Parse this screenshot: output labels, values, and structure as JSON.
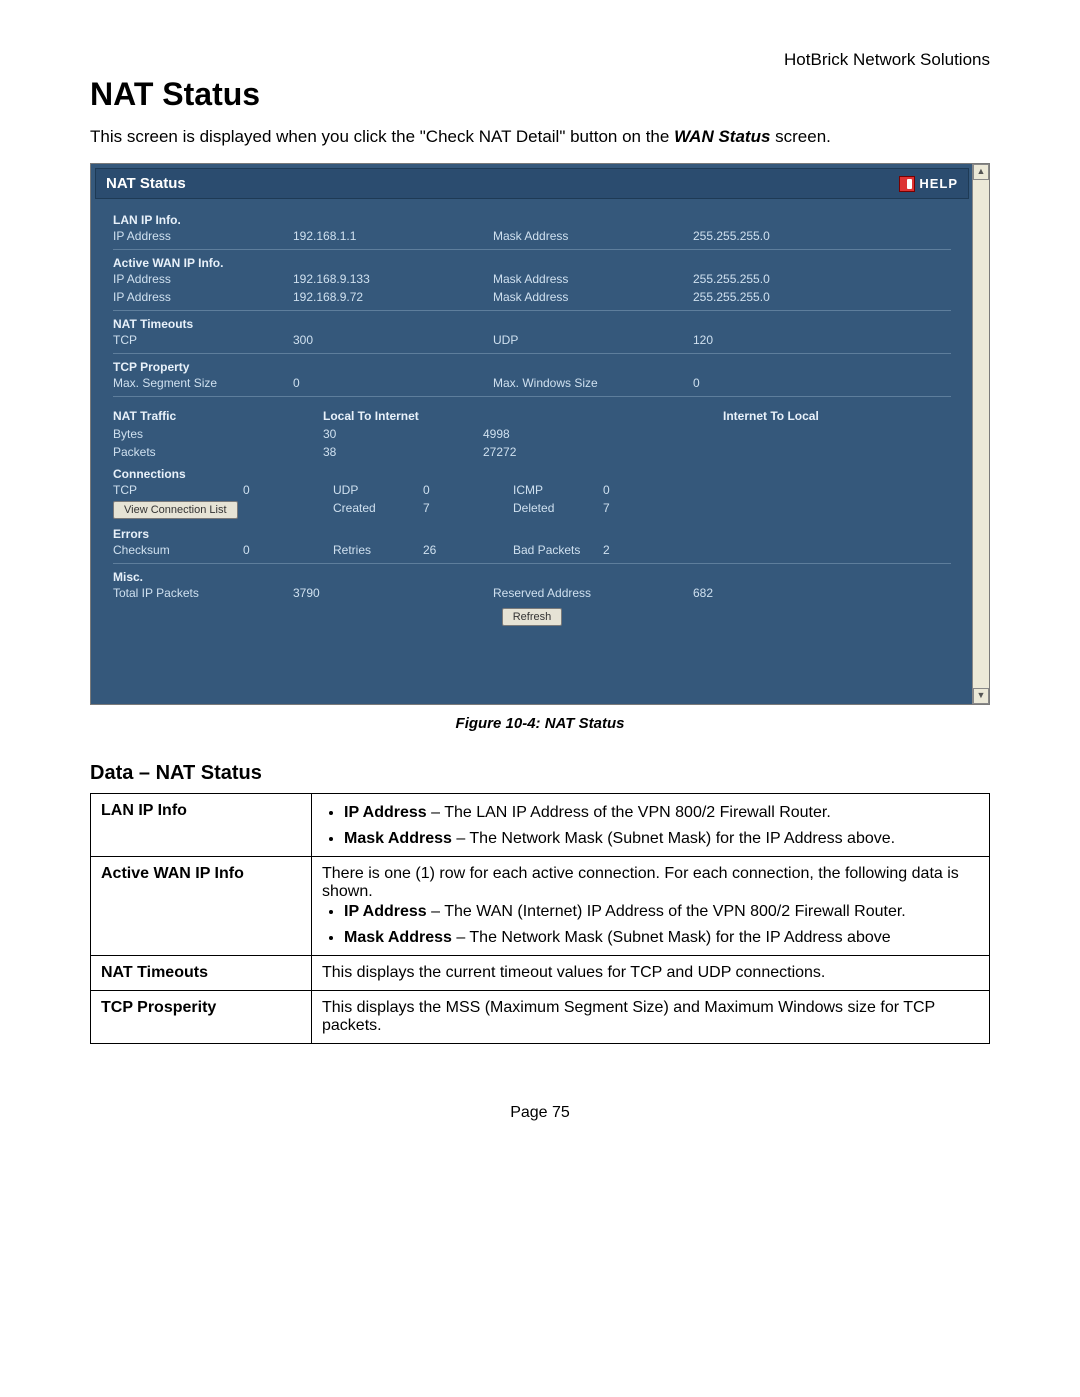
{
  "header_right": "HotBrick Network Solutions",
  "title": "NAT Status",
  "intro_pre": "This screen is displayed when you click the \"Check NAT Detail\" button on the ",
  "intro_em": "WAN Status",
  "intro_post": " screen.",
  "shot": {
    "titlebar": "NAT Status",
    "help": "HELP",
    "lan_ip_info": "LAN IP Info.",
    "ip_address": "IP Address",
    "mask_address": "Mask Address",
    "lan_ip": "192.168.1.1",
    "lan_mask": "255.255.255.0",
    "active_wan": "Active WAN IP Info.",
    "wan": [
      {
        "ip": "192.168.9.133",
        "mask": "255.255.255.0"
      },
      {
        "ip": "192.168.9.72",
        "mask": "255.255.255.0"
      }
    ],
    "nat_timeouts": "NAT Timeouts",
    "tcp_label": "TCP",
    "tcp": "300",
    "udp_label": "UDP",
    "udp": "120",
    "tcp_property": "TCP Property",
    "mss_label": "Max. Segment Size",
    "mss": "0",
    "mws_label": "Max. Windows Size",
    "mws": "0",
    "nat_traffic": "NAT Traffic",
    "local_to_internet": "Local To Internet",
    "internet_to_local": "Internet To Local",
    "bytes_label": "Bytes",
    "bytes_lti": "30",
    "bytes_itl": "4998",
    "packets_label": "Packets",
    "packets_lti": "38",
    "packets_itl": "27272",
    "connections": "Connections",
    "c_tcp_label": "TCP",
    "c_tcp": "0",
    "c_udp_label": "UDP",
    "c_udp": "0",
    "c_icmp_label": "ICMP",
    "c_icmp": "0",
    "view_conn": "View Connection List",
    "created_label": "Created",
    "created": "7",
    "deleted_label": "Deleted",
    "deleted": "7",
    "errors": "Errors",
    "chk_label": "Checksum",
    "chk": "0",
    "retries_label": "Retries",
    "retries": "26",
    "badp_label": "Bad Packets",
    "badp": "2",
    "misc": "Misc.",
    "total_ip_label": "Total IP Packets",
    "total_ip": "3790",
    "reserved_label": "Reserved Address",
    "reserved": "682",
    "refresh": "Refresh"
  },
  "caption": "Figure 10-4: NAT Status",
  "data_heading": "Data – NAT Status",
  "table": {
    "lan_ip_info_k": "LAN IP Info",
    "lan_ip_info_1b": "IP Address",
    "lan_ip_info_1": " – The LAN IP Address of the VPN 800/2 Firewall Router.",
    "lan_ip_info_2b": "Mask Address",
    "lan_ip_info_2": " – The Network Mask (Subnet Mask) for the IP Address above.",
    "active_wan_k": "Active WAN IP Info",
    "active_wan_intro": "There is one (1) row for each active connection. For each connection, the following data is shown.",
    "active_wan_1b": "IP Address",
    "active_wan_1": " – The WAN (Internet) IP Address of the VPN 800/2 Firewall Router.",
    "active_wan_2b": "Mask Address",
    "active_wan_2": " – The Network Mask (Subnet Mask) for the IP Address above",
    "nat_to_k": "NAT Timeouts",
    "nat_to_v": "This displays the current timeout values for TCP and UDP connections.",
    "tcp_p_k": "TCP Prosperity",
    "tcp_p_v": "This displays the MSS (Maximum Segment Size) and Maximum Windows size for TCP packets."
  },
  "page_footer": "Page 75"
}
